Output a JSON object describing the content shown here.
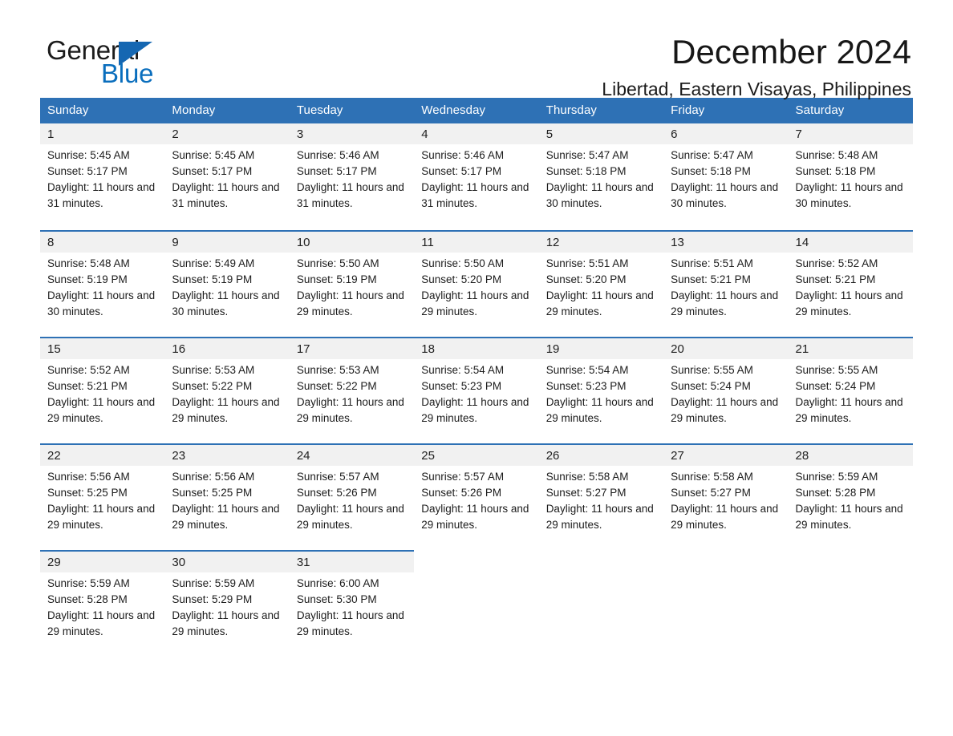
{
  "brand": {
    "name_part1": "General",
    "name_part2": "Blue",
    "triangle_icon": "brand-triangle-icon",
    "accent_color": "#1567b2",
    "blue_text_color": "#0a6ebd"
  },
  "header": {
    "month_title": "December 2024",
    "location": "Libertad, Eastern Visayas, Philippines"
  },
  "theme": {
    "header_blue": "#2e71b5",
    "daynum_band": "#f1f1f1",
    "text": "#1c1c1c"
  },
  "calendar": {
    "weekday_headers": [
      "Sunday",
      "Monday",
      "Tuesday",
      "Wednesday",
      "Thursday",
      "Friday",
      "Saturday"
    ],
    "weeks": [
      [
        {
          "day": "1",
          "sunrise": "Sunrise: 5:45 AM",
          "sunset": "Sunset: 5:17 PM",
          "daylight": "Daylight: 11 hours and 31 minutes."
        },
        {
          "day": "2",
          "sunrise": "Sunrise: 5:45 AM",
          "sunset": "Sunset: 5:17 PM",
          "daylight": "Daylight: 11 hours and 31 minutes."
        },
        {
          "day": "3",
          "sunrise": "Sunrise: 5:46 AM",
          "sunset": "Sunset: 5:17 PM",
          "daylight": "Daylight: 11 hours and 31 minutes."
        },
        {
          "day": "4",
          "sunrise": "Sunrise: 5:46 AM",
          "sunset": "Sunset: 5:17 PM",
          "daylight": "Daylight: 11 hours and 31 minutes."
        },
        {
          "day": "5",
          "sunrise": "Sunrise: 5:47 AM",
          "sunset": "Sunset: 5:18 PM",
          "daylight": "Daylight: 11 hours and 30 minutes."
        },
        {
          "day": "6",
          "sunrise": "Sunrise: 5:47 AM",
          "sunset": "Sunset: 5:18 PM",
          "daylight": "Daylight: 11 hours and 30 minutes."
        },
        {
          "day": "7",
          "sunrise": "Sunrise: 5:48 AM",
          "sunset": "Sunset: 5:18 PM",
          "daylight": "Daylight: 11 hours and 30 minutes."
        }
      ],
      [
        {
          "day": "8",
          "sunrise": "Sunrise: 5:48 AM",
          "sunset": "Sunset: 5:19 PM",
          "daylight": "Daylight: 11 hours and 30 minutes."
        },
        {
          "day": "9",
          "sunrise": "Sunrise: 5:49 AM",
          "sunset": "Sunset: 5:19 PM",
          "daylight": "Daylight: 11 hours and 30 minutes."
        },
        {
          "day": "10",
          "sunrise": "Sunrise: 5:50 AM",
          "sunset": "Sunset: 5:19 PM",
          "daylight": "Daylight: 11 hours and 29 minutes."
        },
        {
          "day": "11",
          "sunrise": "Sunrise: 5:50 AM",
          "sunset": "Sunset: 5:20 PM",
          "daylight": "Daylight: 11 hours and 29 minutes."
        },
        {
          "day": "12",
          "sunrise": "Sunrise: 5:51 AM",
          "sunset": "Sunset: 5:20 PM",
          "daylight": "Daylight: 11 hours and 29 minutes."
        },
        {
          "day": "13",
          "sunrise": "Sunrise: 5:51 AM",
          "sunset": "Sunset: 5:21 PM",
          "daylight": "Daylight: 11 hours and 29 minutes."
        },
        {
          "day": "14",
          "sunrise": "Sunrise: 5:52 AM",
          "sunset": "Sunset: 5:21 PM",
          "daylight": "Daylight: 11 hours and 29 minutes."
        }
      ],
      [
        {
          "day": "15",
          "sunrise": "Sunrise: 5:52 AM",
          "sunset": "Sunset: 5:21 PM",
          "daylight": "Daylight: 11 hours and 29 minutes."
        },
        {
          "day": "16",
          "sunrise": "Sunrise: 5:53 AM",
          "sunset": "Sunset: 5:22 PM",
          "daylight": "Daylight: 11 hours and 29 minutes."
        },
        {
          "day": "17",
          "sunrise": "Sunrise: 5:53 AM",
          "sunset": "Sunset: 5:22 PM",
          "daylight": "Daylight: 11 hours and 29 minutes."
        },
        {
          "day": "18",
          "sunrise": "Sunrise: 5:54 AM",
          "sunset": "Sunset: 5:23 PM",
          "daylight": "Daylight: 11 hours and 29 minutes."
        },
        {
          "day": "19",
          "sunrise": "Sunrise: 5:54 AM",
          "sunset": "Sunset: 5:23 PM",
          "daylight": "Daylight: 11 hours and 29 minutes."
        },
        {
          "day": "20",
          "sunrise": "Sunrise: 5:55 AM",
          "sunset": "Sunset: 5:24 PM",
          "daylight": "Daylight: 11 hours and 29 minutes."
        },
        {
          "day": "21",
          "sunrise": "Sunrise: 5:55 AM",
          "sunset": "Sunset: 5:24 PM",
          "daylight": "Daylight: 11 hours and 29 minutes."
        }
      ],
      [
        {
          "day": "22",
          "sunrise": "Sunrise: 5:56 AM",
          "sunset": "Sunset: 5:25 PM",
          "daylight": "Daylight: 11 hours and 29 minutes."
        },
        {
          "day": "23",
          "sunrise": "Sunrise: 5:56 AM",
          "sunset": "Sunset: 5:25 PM",
          "daylight": "Daylight: 11 hours and 29 minutes."
        },
        {
          "day": "24",
          "sunrise": "Sunrise: 5:57 AM",
          "sunset": "Sunset: 5:26 PM",
          "daylight": "Daylight: 11 hours and 29 minutes."
        },
        {
          "day": "25",
          "sunrise": "Sunrise: 5:57 AM",
          "sunset": "Sunset: 5:26 PM",
          "daylight": "Daylight: 11 hours and 29 minutes."
        },
        {
          "day": "26",
          "sunrise": "Sunrise: 5:58 AM",
          "sunset": "Sunset: 5:27 PM",
          "daylight": "Daylight: 11 hours and 29 minutes."
        },
        {
          "day": "27",
          "sunrise": "Sunrise: 5:58 AM",
          "sunset": "Sunset: 5:27 PM",
          "daylight": "Daylight: 11 hours and 29 minutes."
        },
        {
          "day": "28",
          "sunrise": "Sunrise: 5:59 AM",
          "sunset": "Sunset: 5:28 PM",
          "daylight": "Daylight: 11 hours and 29 minutes."
        }
      ],
      [
        {
          "day": "29",
          "sunrise": "Sunrise: 5:59 AM",
          "sunset": "Sunset: 5:28 PM",
          "daylight": "Daylight: 11 hours and 29 minutes."
        },
        {
          "day": "30",
          "sunrise": "Sunrise: 5:59 AM",
          "sunset": "Sunset: 5:29 PM",
          "daylight": "Daylight: 11 hours and 29 minutes."
        },
        {
          "day": "31",
          "sunrise": "Sunrise: 6:00 AM",
          "sunset": "Sunset: 5:30 PM",
          "daylight": "Daylight: 11 hours and 29 minutes."
        },
        null,
        null,
        null,
        null
      ]
    ]
  }
}
